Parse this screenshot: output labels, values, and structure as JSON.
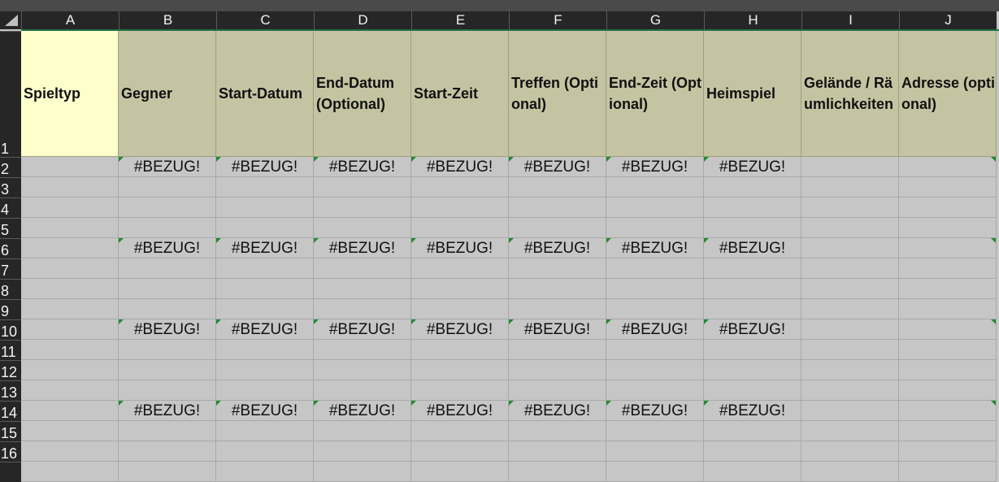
{
  "columns": [
    "A",
    "B",
    "C",
    "D",
    "E",
    "F",
    "G",
    "H",
    "I",
    "J"
  ],
  "row_numbers": [
    "1",
    "2",
    "3",
    "4",
    "5",
    "6",
    "7",
    "8",
    "9",
    "10",
    "11",
    "12",
    "13",
    "14",
    "15",
    "16"
  ],
  "header": [
    "Spieltyp",
    "Gegner",
    "Start-Datum",
    "End-Datum (Optional)",
    "Start-Zeit",
    "Treffen (Optional)",
    "End-Zeit (Optional)",
    "Heimspiel",
    "Gelände / Räumlichkeiten",
    "Adresse (optional)"
  ],
  "error_text": "#BEZUG!",
  "error_rows": [
    "2",
    "6",
    "10",
    "14"
  ],
  "error_columns": [
    "B",
    "C",
    "D",
    "E",
    "F",
    "G",
    "H"
  ],
  "colors": {
    "column_header_bg": "#262626",
    "header_fill": "#c4c4a2",
    "spieltyp_fill": "#ffffcc",
    "cell_fill": "#c6c6c6",
    "error_indicator": "#1e8c2f",
    "selection_border": "#1e7145"
  }
}
